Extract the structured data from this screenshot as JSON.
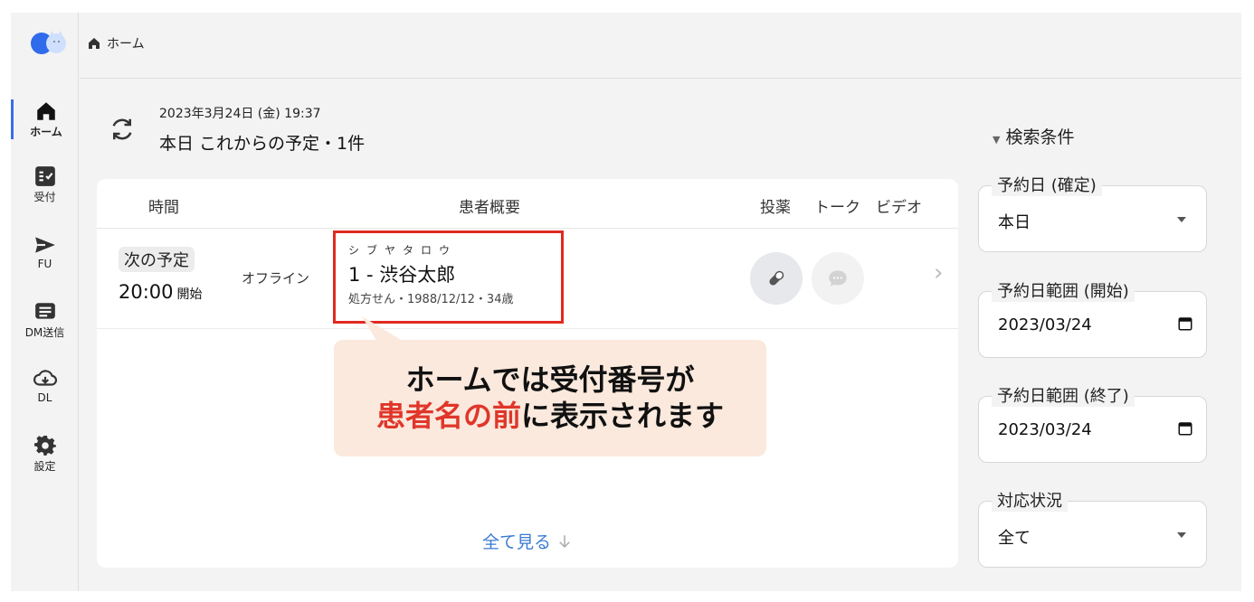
{
  "sidebar": {
    "items": [
      {
        "label": "ホーム",
        "icon": "home-icon",
        "active": true
      },
      {
        "label": "受付",
        "icon": "checklist-icon"
      },
      {
        "label": "FU",
        "icon": "send-icon"
      },
      {
        "label": "DM送信",
        "icon": "message-list-icon"
      },
      {
        "label": "DL",
        "icon": "cloud-download-icon"
      },
      {
        "label": "設定",
        "icon": "gear-icon"
      }
    ]
  },
  "breadcrumb": {
    "label": "ホーム",
    "icon": "home-icon"
  },
  "header": {
    "datetime": "2023年3月24日 (金) 19:37",
    "title": "本日 これからの予定・1件"
  },
  "table": {
    "columns": [
      "時間",
      "患者概要",
      "投薬",
      "トーク",
      "ビデオ"
    ],
    "rows": [
      {
        "badge": "次の予定",
        "time": "20:00",
        "time_suffix": "開始",
        "mode": "オフライン",
        "kana": "シブヤタロウ",
        "name": "1 - 渋谷太郎",
        "meta": "処方せん・1988/12/12・34歳"
      }
    ],
    "see_all": "全て見る"
  },
  "callout": {
    "line1": "ホームでは受付番号が",
    "line2_red": "患者名の前",
    "line2_rest": "に表示されます"
  },
  "filters": {
    "toggle_label": "検索条件",
    "date": {
      "label": "予約日 (確定)",
      "value": "本日"
    },
    "range_start": {
      "label": "予約日範囲 (開始)",
      "value": "2023/03/24"
    },
    "range_end": {
      "label": "予約日範囲 (終了)",
      "value": "2023/03/24"
    },
    "status": {
      "label": "対応状況",
      "value": "全て"
    }
  },
  "colors": {
    "accent": "#3b6ee6",
    "highlight": "#e02a1f",
    "callout_bg": "#fbe9dd",
    "link": "#3b7bd1"
  }
}
